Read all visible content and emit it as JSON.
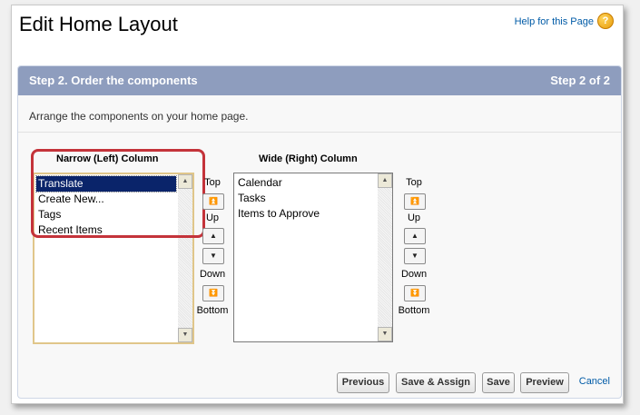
{
  "page": {
    "title": "Edit Home Layout",
    "help_link": "Help for this Page",
    "help_icon": "help-question-icon"
  },
  "step": {
    "title": "Step 2. Order the components",
    "count": "Step 2 of 2",
    "instructions": "Arrange the components on your home page."
  },
  "narrow_column": {
    "label": "Narrow (Left) Column",
    "items": [
      "Translate",
      "Create New...",
      "Tags",
      "Recent Items"
    ],
    "selected_index": 0
  },
  "wide_column": {
    "label": "Wide (Right) Column",
    "items": [
      "Calendar",
      "Tasks",
      "Items to Approve"
    ]
  },
  "order_controls": {
    "top": "Top",
    "up": "Up",
    "down": "Down",
    "bottom": "Bottom"
  },
  "actions": {
    "previous": "Previous",
    "save_assign": "Save & Assign",
    "save": "Save",
    "preview": "Preview",
    "cancel": "Cancel"
  },
  "colors": {
    "header_bg": "#8e9dbe",
    "link": "#015ba7",
    "highlight": "#c4333a",
    "selection": "#0a246a"
  }
}
